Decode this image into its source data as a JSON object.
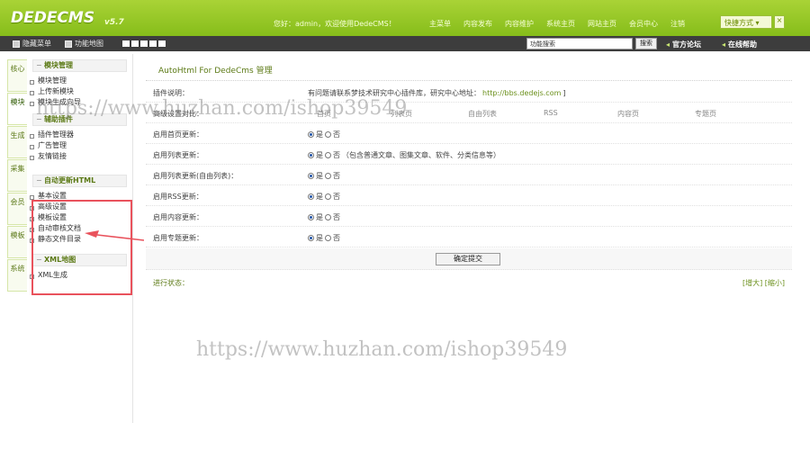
{
  "header": {
    "logo": "DEDECMS",
    "version": "v5.7",
    "greeting": "您好：admin，欢迎使用DedeCMS！",
    "nav": [
      "主菜单",
      "内容发布",
      "内容维护",
      "系统主页",
      "网站主页",
      "会员中心",
      "注销"
    ],
    "quick_menu": "快捷方式",
    "quick_menu_arrow": "▾",
    "close": "×"
  },
  "toolbar": {
    "hide_menu": "隐藏菜单",
    "function_map": "功能地图",
    "search_value": "功能搜索",
    "search_button": "搜索",
    "official_forum": "官方论坛",
    "online_help": "在线帮助"
  },
  "vtabs": [
    {
      "label": "核心"
    },
    {
      "label": "模块",
      "active": true
    },
    {
      "label": "生成"
    },
    {
      "label": "采集"
    },
    {
      "label": "会员"
    },
    {
      "label": "模板"
    },
    {
      "label": "系统"
    }
  ],
  "leftmenu": {
    "group1": {
      "title": "模块管理",
      "items": [
        "模块管理",
        "上传新模块",
        "模块生成向导"
      ]
    },
    "group2": {
      "title": "辅助插件",
      "items": [
        "插件管理器",
        "广告管理",
        "友情链接"
      ]
    },
    "group3": {
      "title": "自动更新HTML",
      "items": [
        "基本设置",
        "高级设置",
        "模板设置",
        "自动审核文档",
        "静态文件目录"
      ]
    },
    "group4": {
      "title": "XML地图",
      "items": [
        "XML生成"
      ]
    }
  },
  "main": {
    "title": "AutoHtml For DedeCms 管理",
    "plugin_label": "插件说明：",
    "plugin_desc": "有问题请联系梦技术研究中心插件库，研究中心地址：",
    "plugin_link": "http://bbs.dedejs.com",
    "plugin_close": "]",
    "advanced_label": "高级设置对比：",
    "columns": [
      "首页",
      "列表页",
      "自由列表",
      "RSS",
      "内容页",
      "专题页"
    ],
    "rows": [
      {
        "label": "启用首页更新：",
        "yes": "是",
        "no": "否",
        "note": ""
      },
      {
        "label": "启用列表更新：",
        "yes": "是",
        "no": "否",
        "note": "（包含普通文章、图集文章、软件、分类信息等）"
      },
      {
        "label": "启用列表更新(自由列表)：",
        "yes": "是",
        "no": "否",
        "note": ""
      },
      {
        "label": "启用RSS更新：",
        "yes": "是",
        "no": "否",
        "note": ""
      },
      {
        "label": "启用内容更新：",
        "yes": "是",
        "no": "否",
        "note": ""
      },
      {
        "label": "启用专题更新：",
        "yes": "是",
        "no": "否",
        "note": ""
      }
    ],
    "submit": "确定提交",
    "status_label": "进行状态：",
    "enlarge": "[增大]",
    "shrink": "[缩小]"
  },
  "watermark": "https://www.huzhan.com/ishop39549",
  "colors": {
    "header_green": "#8fc41f",
    "toolbar_dark": "#3d3d3d",
    "highlight_red": "#e9525c",
    "accent_green": "#5c7a16"
  }
}
